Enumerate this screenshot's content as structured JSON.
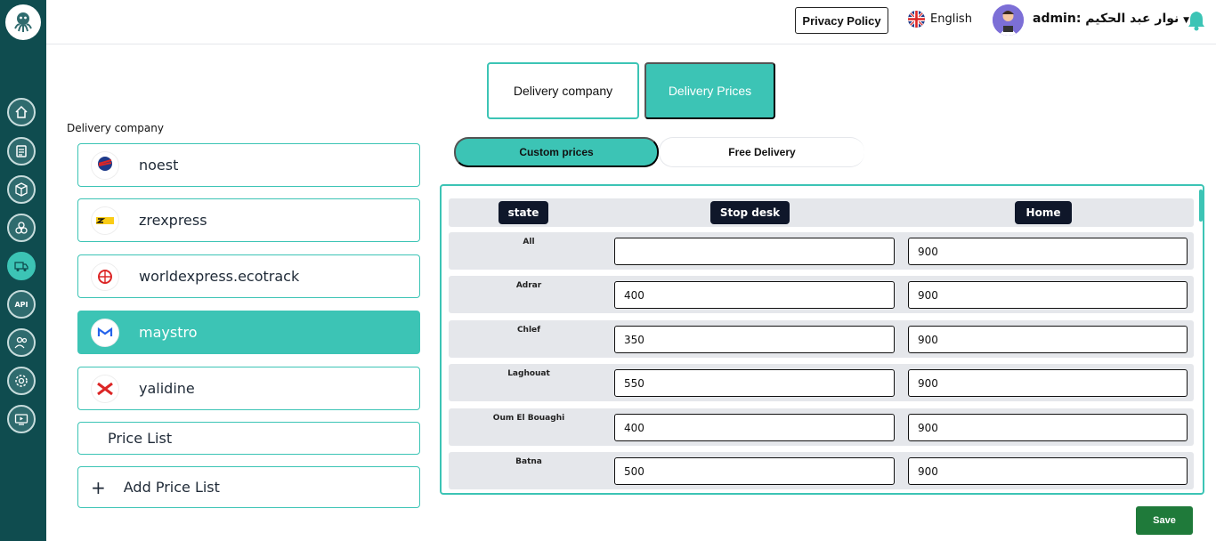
{
  "topbar": {
    "privacy_label": "Privacy Policy",
    "language_label": "English",
    "user_label": "admin: نوار عبد الحكيم"
  },
  "tabs": {
    "company_label": "Delivery company",
    "prices_label": "Delivery Prices"
  },
  "sidebar": {
    "api_label": "API"
  },
  "left": {
    "section_label": "Delivery company",
    "companies": [
      {
        "name": "noest"
      },
      {
        "name": "zrexpress"
      },
      {
        "name": "worldexpress.ecotrack"
      },
      {
        "name": "maystro"
      },
      {
        "name": "yalidine"
      }
    ],
    "price_list_label": "Price List",
    "add_price_list_label": "Add Price List",
    "add_symbol": "+"
  },
  "pricing": {
    "custom_label": "Custom prices",
    "free_label": "Free Delivery",
    "headers": {
      "state": "state",
      "desk": "Stop desk",
      "home": "Home"
    },
    "rows": [
      {
        "state": "All",
        "desk": "",
        "home": "900"
      },
      {
        "state": "Adrar",
        "desk": "400",
        "home": "900"
      },
      {
        "state": "Chlef",
        "desk": "350",
        "home": "900"
      },
      {
        "state": "Laghouat",
        "desk": "550",
        "home": "900"
      },
      {
        "state": "Oum El Bouaghi",
        "desk": "400",
        "home": "900"
      },
      {
        "state": "Batna",
        "desk": "500",
        "home": "900"
      }
    ]
  },
  "save_label": "Save",
  "colors": {
    "sidebar": "#0f4c4f",
    "accent": "#3cc4b5",
    "save": "#1f7a3a",
    "header_pill": "#0f172a"
  }
}
